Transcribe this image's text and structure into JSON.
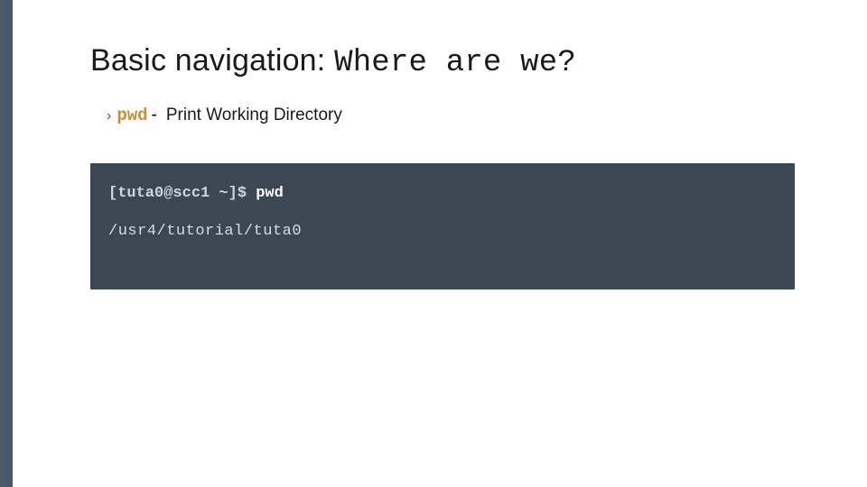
{
  "title": {
    "plain": "Basic navigation: ",
    "mono": "Where are we?"
  },
  "bullet": {
    "glyph": "›",
    "command": "pwd",
    "separator": " -  ",
    "description": "Print Working Directory"
  },
  "terminal": {
    "prompt": "[tuta0@scc1 ~]$ ",
    "typed": "pwd",
    "output": "/usr4/tutorial/tuta0"
  }
}
